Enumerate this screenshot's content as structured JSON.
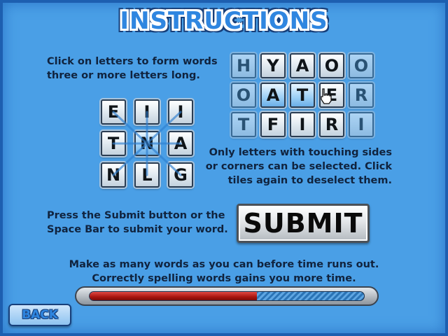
{
  "title": "INSTRUCTIONS",
  "text1": [
    "Click on letters to form words",
    "three or more letters long."
  ],
  "text2": [
    "Only letters with touching sides",
    "or corners can be selected. Click",
    "tiles again to deselect them."
  ],
  "text3": [
    "Press the Submit button or the",
    "Space Bar to submit your word."
  ],
  "text4": [
    "Make as many words as you can before time runs out.",
    "Correctly spelling words gains you more time."
  ],
  "grid_small": [
    "E",
    "I",
    "I",
    "T",
    "N",
    "A",
    "N",
    "L",
    "G"
  ],
  "grid_large": [
    "H",
    "Y",
    "A",
    "O",
    "O",
    "O",
    "A",
    "T",
    "E",
    "R",
    "T",
    "F",
    "I",
    "R",
    "I"
  ],
  "submit_label": "SUBMIT",
  "back_label": "BACK",
  "timer": {
    "remaining_fraction": 0.61
  },
  "colors": {
    "background": "#4a9fe6",
    "title": "#2f86e0",
    "timer_fill": "#c81f19"
  },
  "icons": {
    "cursor": "hand-pointer-icon"
  }
}
